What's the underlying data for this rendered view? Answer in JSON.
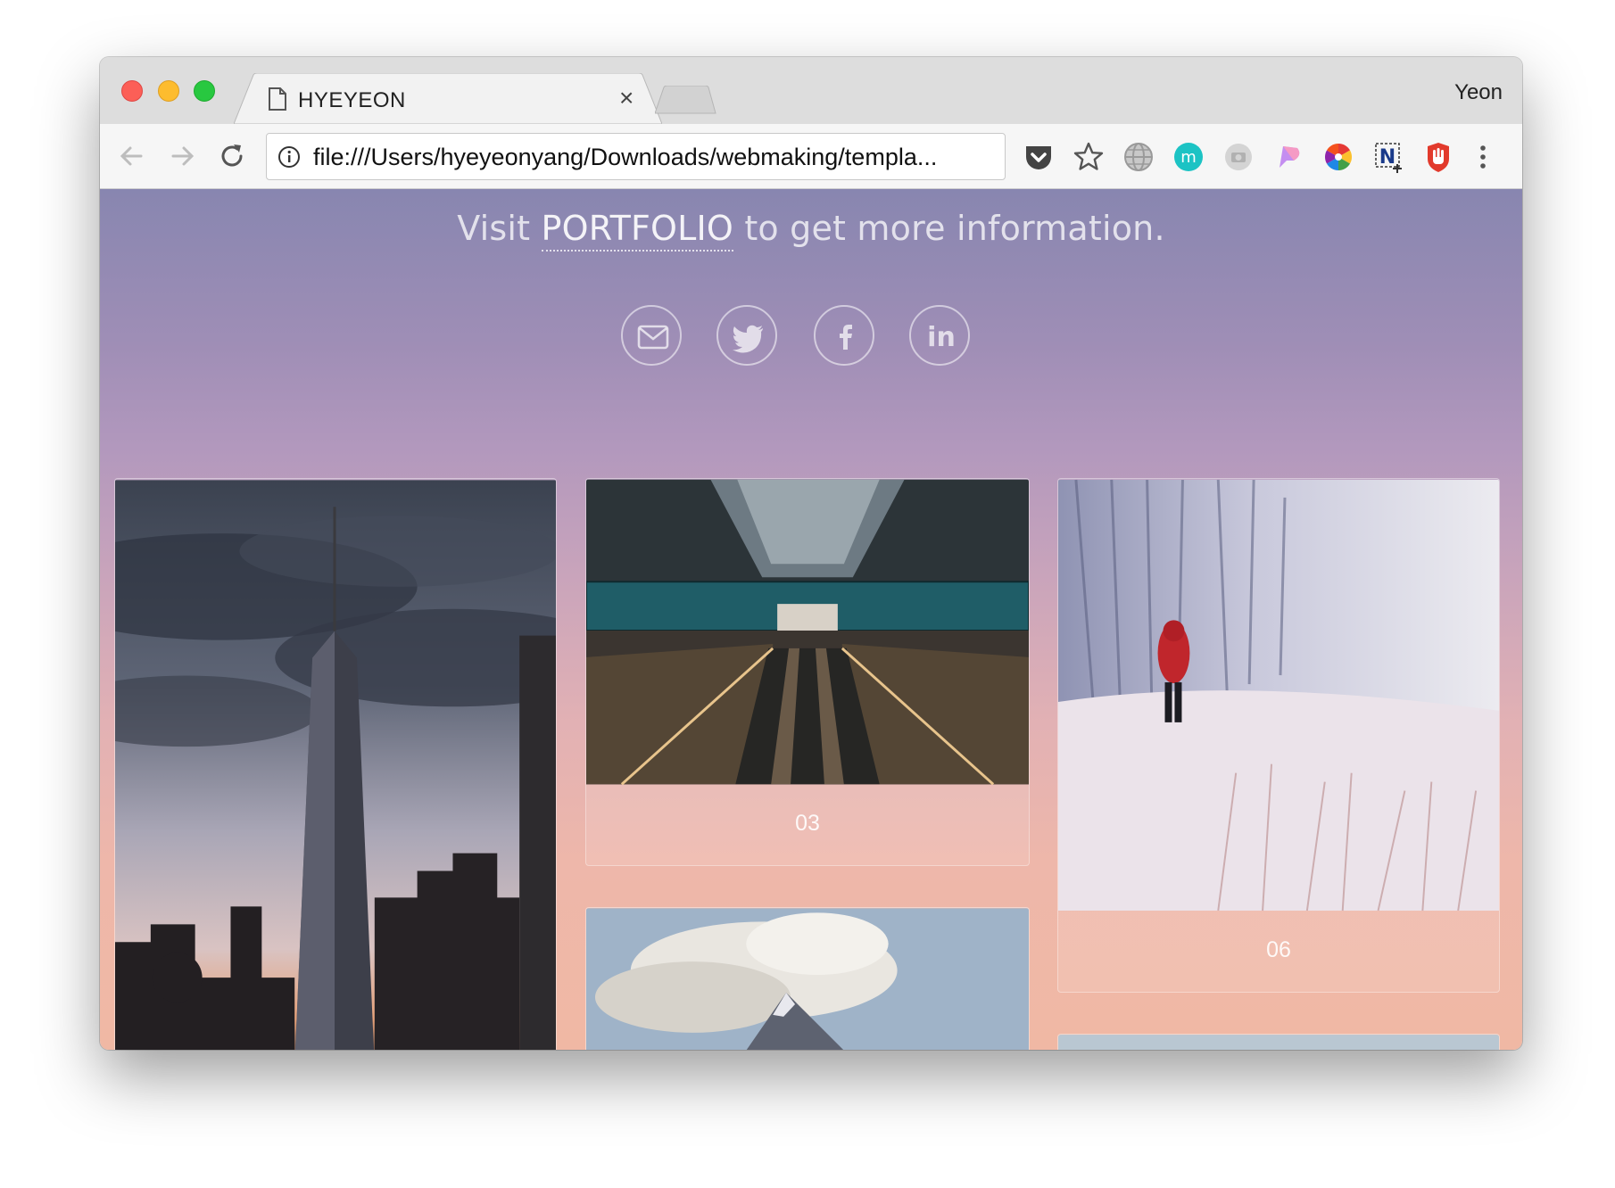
{
  "browser": {
    "tab_title": "HYEYEON",
    "tab_close": "×",
    "profile_name": "Yeon",
    "url": "file:///Users/hyeyeonyang/Downloads/webmaking/templa..."
  },
  "icons": [
    "back-arrow-icon",
    "forward-arrow-icon",
    "reload-icon",
    "info-icon",
    "pocket-icon",
    "star-icon",
    "globe-icon",
    "m-extension-icon",
    "camera-extension-icon",
    "pen-extension-icon",
    "color-wheel-icon",
    "n-extension-icon",
    "adblock-hand-icon",
    "menu-dots-icon",
    "mail-icon",
    "twitter-icon",
    "facebook-icon",
    "linkedin-icon"
  ],
  "page": {
    "headline_prefix": "Visit ",
    "headline_link": "PORTFOLIO",
    "headline_suffix": " to get more information.",
    "cards": [
      {
        "caption": "03"
      },
      {
        "caption": "06"
      }
    ]
  },
  "colors": {
    "gradient_top": "#8886b0",
    "gradient_bottom": "#f0b8a4"
  }
}
